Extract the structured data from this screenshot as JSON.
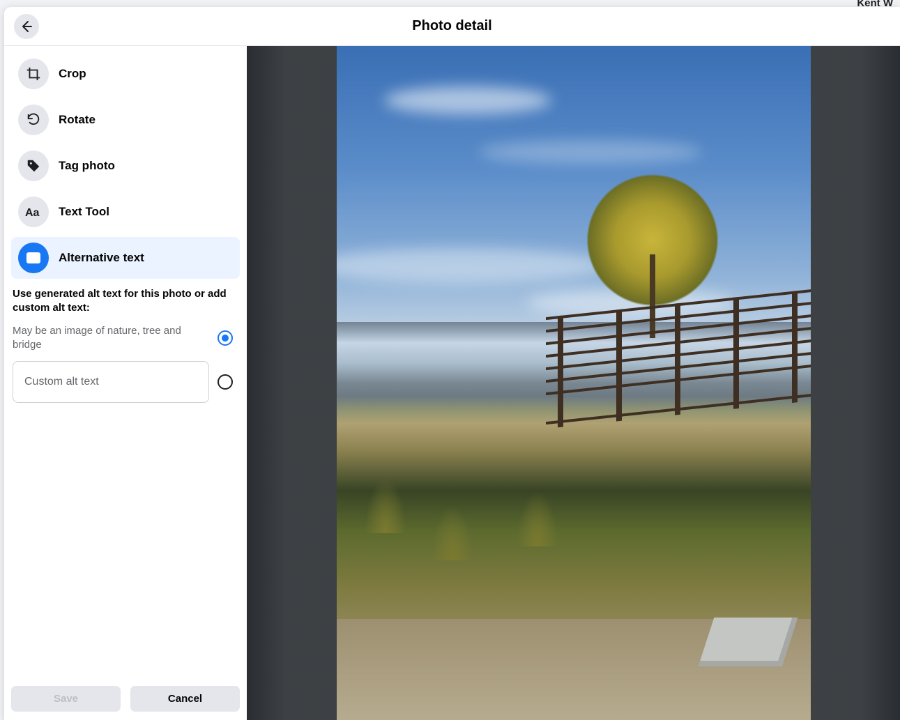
{
  "header": {
    "title": "Photo detail",
    "behind_user": "Kent W"
  },
  "sidebar": {
    "tools": [
      {
        "id": "crop",
        "label": "Crop",
        "active": false
      },
      {
        "id": "rotate",
        "label": "Rotate",
        "active": false
      },
      {
        "id": "tag",
        "label": "Tag photo",
        "active": false
      },
      {
        "id": "text",
        "label": "Text Tool",
        "active": false
      },
      {
        "id": "alt",
        "label": "Alternative text",
        "active": true
      }
    ],
    "alt_text": {
      "heading": "Use generated alt text for this photo or add custom alt text:",
      "generated": "May be an image of nature, tree and bridge",
      "custom_placeholder": "Custom alt text",
      "custom_value": "",
      "selected": "generated"
    },
    "buttons": {
      "save": "Save",
      "cancel": "Cancel"
    }
  }
}
